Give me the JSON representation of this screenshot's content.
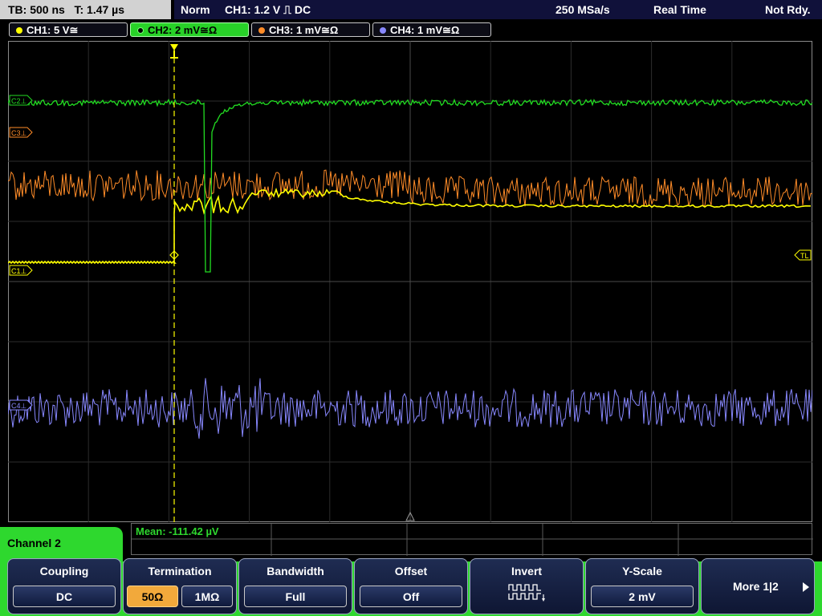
{
  "topbar": {
    "timebase": "TB: 500 ns",
    "trigger_time": "T: 1.47 µs",
    "mode": "Norm",
    "trigger_info": "CH1: 1.2 V ⎍ DC",
    "sample_rate": "250 MSa/s",
    "acq_mode": "Real Time",
    "status": "Not Rdy."
  },
  "channels": [
    {
      "label": "CH1: 5 V≅",
      "color": "#ffff00"
    },
    {
      "label": "CH2: 2 mV≅Ω",
      "color": "#22dd22"
    },
    {
      "label": "CH3: 1 mV≅Ω",
      "color": "#ff8c28"
    },
    {
      "label": "CH4: 1 mV≅Ω",
      "color": "#8888ff"
    }
  ],
  "markers": {
    "c1": "C1⊥",
    "c2": "C2⊥",
    "c3": "C3⊥",
    "c4": "C4⊥",
    "tl": "TL"
  },
  "measurement": {
    "mean": "Mean: -111.42 µV"
  },
  "menu": {
    "channel_title": "Channel 2",
    "coupling": {
      "title": "Coupling",
      "value": "DC"
    },
    "termination": {
      "title": "Termination",
      "opt1": "50Ω",
      "opt2": "1MΩ"
    },
    "bandwidth": {
      "title": "Bandwidth",
      "value": "Full"
    },
    "offset": {
      "title": "Offset",
      "value": "Off"
    },
    "invert": {
      "title": "Invert"
    },
    "yscale": {
      "title": "Y-Scale",
      "value": "2 mV"
    },
    "more": {
      "title": "More 1|2"
    }
  }
}
